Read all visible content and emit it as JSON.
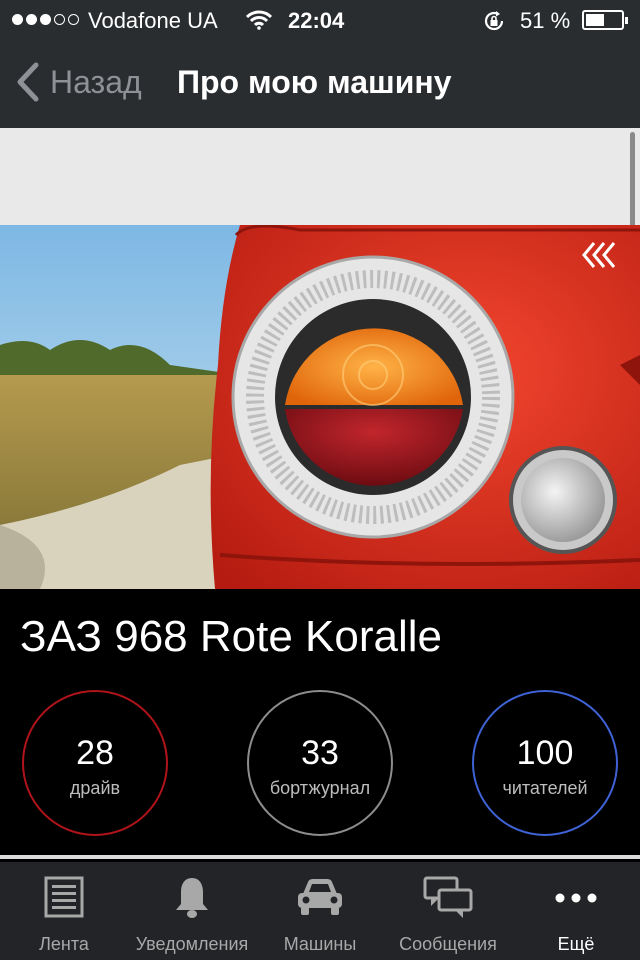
{
  "status_bar": {
    "carrier": "Vodafone UA",
    "time": "22:04",
    "battery": "51 %"
  },
  "nav": {
    "back_label": "Назад",
    "title": "Про мою машину"
  },
  "car": {
    "name": "ЗАЗ 968 Rote Koralle",
    "stats": [
      {
        "value": "28",
        "label": "драйв",
        "color": "#b0141a"
      },
      {
        "value": "33",
        "label": "бортжурнал",
        "color": "#8d8d8d"
      },
      {
        "value": "100",
        "label": "читателей",
        "color": "#3f63d6"
      }
    ]
  },
  "tabbar": {
    "items": [
      {
        "label": "Лента",
        "icon": "feed-icon"
      },
      {
        "label": "Уведомления",
        "icon": "bell-icon"
      },
      {
        "label": "Машины",
        "icon": "car-icon"
      },
      {
        "label": "Сообщения",
        "icon": "chat-icon"
      },
      {
        "label": "Ещё",
        "icon": "more-dots-icon",
        "active": true
      }
    ]
  }
}
